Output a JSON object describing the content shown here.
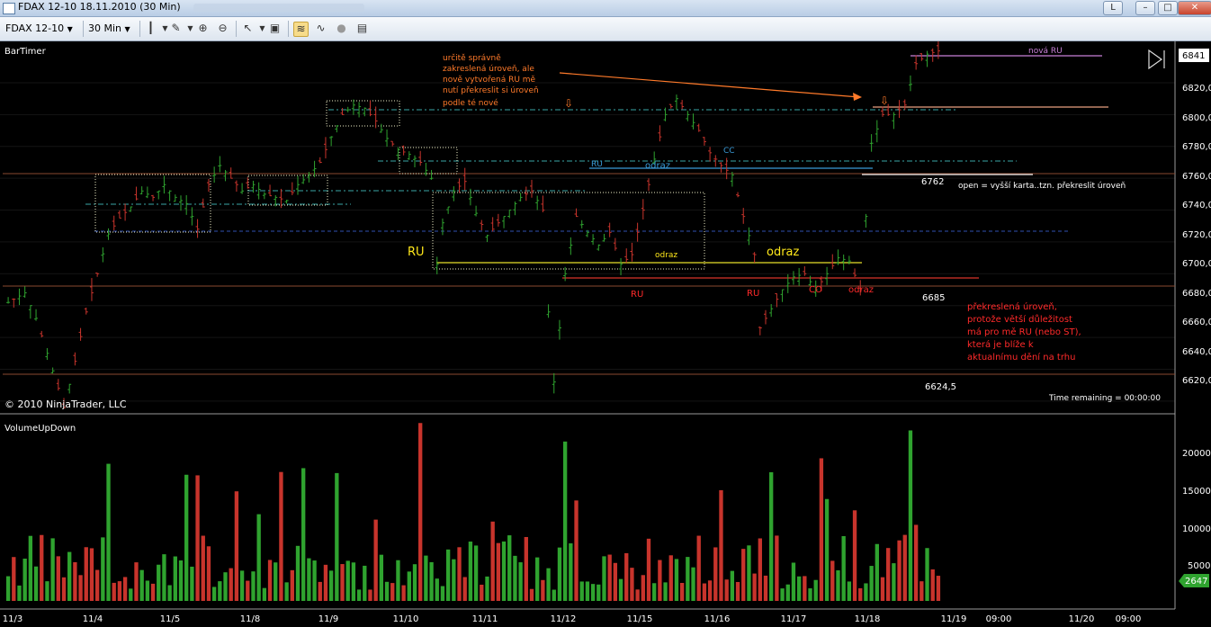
{
  "window": {
    "title": "FDAX 12-10  18.11.2010 (30 Min)",
    "minimize": "–",
    "restore": "L",
    "maximize": "□",
    "close": "✕"
  },
  "toolbar": {
    "instrument": "FDAX 12-10",
    "interval": "30 Min"
  },
  "colors": {
    "up_bar": "#2fa32f",
    "down_bar": "#c8342c",
    "background": "#000000",
    "axis_text": "#ffffff",
    "annotation_orange": "#ff7a2a",
    "annotation_red": "#ff2a2a",
    "annotation_yellow": "#ffe81a"
  },
  "price_panel": {
    "indicator": "BarTimer",
    "copyright": "© 2010 NinjaTrader, LLC",
    "time_remaining": "Time remaining = 00:00:00",
    "last_price": "6841",
    "price_ticks": [
      "6820,0",
      "6800,0",
      "6780,0",
      "6760,0",
      "6740,0",
      "6720,0",
      "6700,0",
      "6680,0",
      "6660,0",
      "6640,0",
      "6620,0"
    ]
  },
  "volume_panel": {
    "indicator": "VolumeUpDown",
    "last_volume": "2647",
    "volume_ticks": [
      "20000",
      "15000",
      "10000",
      "5000"
    ]
  },
  "x_axis": {
    "labels": [
      "11/3",
      "11/4",
      "11/5",
      "11/8",
      "11/9",
      "11/10",
      "11/11",
      "11/12",
      "11/15",
      "11/16",
      "11/17",
      "11/18",
      "11/19",
      "09:00",
      "11/20",
      "09:00"
    ]
  },
  "annotations": {
    "note_top": [
      "určitě správně",
      "zakreslená úroveň, ale",
      "nově vytvořená RU mě",
      "nutí překreslit si úroveň",
      "podle té nové"
    ],
    "nova_ru": "nová RU",
    "level_6762": "6762",
    "open_note": "open = vyšší karta..tzn. překreslit úroveň",
    "level_6685": "6685",
    "note_right": [
      "překreslená úroveň,",
      "protože větší důležitost",
      "má pro mě RU (nebo ST),",
      "která je blíže k",
      "aktualnímu dění na trhu"
    ],
    "level_6624": "6624,5",
    "ru_yellow": "RU",
    "odraz_yellow_small": "odraz",
    "odraz_yellow_big": "odraz",
    "ru_blue": "RU",
    "odraz_blue": "odraz",
    "cc_blue": "CC",
    "ru_red_1": "RU",
    "ru_red_2": "RU",
    "co_red": "CO",
    "odraz_red": "odraz"
  },
  "chart_data": {
    "type": "candlestick",
    "instrument": "FDAX 12-10",
    "interval": "30 Min",
    "y_range": [
      6612,
      6846
    ],
    "volume_range": [
      0,
      25000
    ],
    "sessions": [
      "11/3",
      "11/4",
      "11/5",
      "11/8",
      "11/9",
      "11/10",
      "11/11",
      "11/12",
      "11/15",
      "11/16",
      "11/17",
      "11/18"
    ],
    "price_path": [
      [
        0,
        6682
      ],
      [
        3,
        6688
      ],
      [
        5,
        6672
      ],
      [
        7,
        6650
      ],
      [
        9,
        6628
      ],
      [
        10,
        6616
      ],
      [
        12,
        6645
      ],
      [
        14,
        6676
      ],
      [
        16,
        6700
      ],
      [
        18,
        6725
      ],
      [
        20,
        6735
      ],
      [
        22,
        6742
      ],
      [
        24,
        6752
      ],
      [
        26,
        6748
      ],
      [
        28,
        6756
      ],
      [
        30,
        6748
      ],
      [
        32,
        6744
      ],
      [
        34,
        6728
      ],
      [
        36,
        6756
      ],
      [
        38,
        6768
      ],
      [
        40,
        6760
      ],
      [
        42,
        6752
      ],
      [
        44,
        6756
      ],
      [
        46,
        6750
      ],
      [
        48,
        6748
      ],
      [
        50,
        6746
      ],
      [
        52,
        6756
      ],
      [
        54,
        6762
      ],
      [
        56,
        6770
      ],
      [
        58,
        6786
      ],
      [
        60,
        6800
      ],
      [
        62,
        6806
      ],
      [
        64,
        6804
      ],
      [
        66,
        6796
      ],
      [
        68,
        6785
      ],
      [
        70,
        6778
      ],
      [
        72,
        6775
      ],
      [
        74,
        6770
      ],
      [
        76,
        6760
      ],
      [
        77,
        6706
      ],
      [
        78,
        6732
      ],
      [
        80,
        6752
      ],
      [
        82,
        6758
      ],
      [
        84,
        6738
      ],
      [
        86,
        6724
      ],
      [
        88,
        6732
      ],
      [
        90,
        6740
      ],
      [
        92,
        6748
      ],
      [
        94,
        6752
      ],
      [
        96,
        6740
      ],
      [
        97,
        6676
      ],
      [
        98,
        6632
      ],
      [
        100,
        6700
      ],
      [
        102,
        6736
      ],
      [
        104,
        6726
      ],
      [
        106,
        6718
      ],
      [
        108,
        6726
      ],
      [
        110,
        6706
      ],
      [
        112,
        6712
      ],
      [
        114,
        6740
      ],
      [
        116,
        6772
      ],
      [
        118,
        6800
      ],
      [
        120,
        6810
      ],
      [
        122,
        6800
      ],
      [
        124,
        6790
      ],
      [
        126,
        6776
      ],
      [
        128,
        6768
      ],
      [
        130,
        6762
      ],
      [
        132,
        6736
      ],
      [
        134,
        6712
      ],
      [
        135,
        6666
      ],
      [
        137,
        6678
      ],
      [
        139,
        6690
      ],
      [
        141,
        6698
      ],
      [
        143,
        6700
      ],
      [
        145,
        6690
      ],
      [
        147,
        6700
      ],
      [
        149,
        6710
      ],
      [
        151,
        6708
      ],
      [
        153,
        6690
      ],
      [
        155,
        6782
      ],
      [
        157,
        6800
      ],
      [
        159,
        6800
      ],
      [
        161,
        6806
      ],
      [
        163,
        6832
      ],
      [
        165,
        6838
      ],
      [
        167,
        6840
      ]
    ],
    "drawn_levels": [
      6808,
      6804,
      6785,
      6772,
      6765,
      6762,
      6750,
      6740,
      6722,
      6701,
      6691,
      6685,
      6624.5
    ],
    "drawn_level_labels": [
      "6762",
      "6685",
      "6624,5"
    ]
  }
}
